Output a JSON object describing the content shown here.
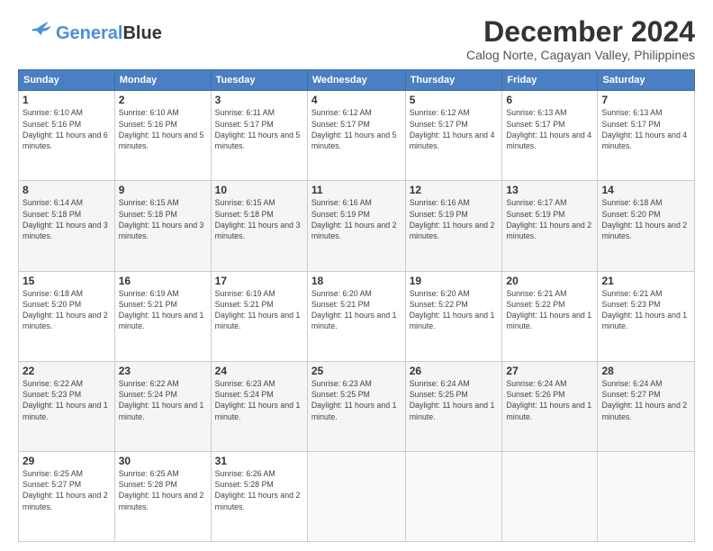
{
  "header": {
    "logo_general": "General",
    "logo_blue": "Blue",
    "month_title": "December 2024",
    "location": "Calog Norte, Cagayan Valley, Philippines"
  },
  "days_of_week": [
    "Sunday",
    "Monday",
    "Tuesday",
    "Wednesday",
    "Thursday",
    "Friday",
    "Saturday"
  ],
  "weeks": [
    [
      {
        "day": "1",
        "sunrise": "Sunrise: 6:10 AM",
        "sunset": "Sunset: 5:16 PM",
        "daylight": "Daylight: 11 hours and 6 minutes."
      },
      {
        "day": "2",
        "sunrise": "Sunrise: 6:10 AM",
        "sunset": "Sunset: 5:16 PM",
        "daylight": "Daylight: 11 hours and 5 minutes."
      },
      {
        "day": "3",
        "sunrise": "Sunrise: 6:11 AM",
        "sunset": "Sunset: 5:17 PM",
        "daylight": "Daylight: 11 hours and 5 minutes."
      },
      {
        "day": "4",
        "sunrise": "Sunrise: 6:12 AM",
        "sunset": "Sunset: 5:17 PM",
        "daylight": "Daylight: 11 hours and 5 minutes."
      },
      {
        "day": "5",
        "sunrise": "Sunrise: 6:12 AM",
        "sunset": "Sunset: 5:17 PM",
        "daylight": "Daylight: 11 hours and 4 minutes."
      },
      {
        "day": "6",
        "sunrise": "Sunrise: 6:13 AM",
        "sunset": "Sunset: 5:17 PM",
        "daylight": "Daylight: 11 hours and 4 minutes."
      },
      {
        "day": "7",
        "sunrise": "Sunrise: 6:13 AM",
        "sunset": "Sunset: 5:17 PM",
        "daylight": "Daylight: 11 hours and 4 minutes."
      }
    ],
    [
      {
        "day": "8",
        "sunrise": "Sunrise: 6:14 AM",
        "sunset": "Sunset: 5:18 PM",
        "daylight": "Daylight: 11 hours and 3 minutes."
      },
      {
        "day": "9",
        "sunrise": "Sunrise: 6:15 AM",
        "sunset": "Sunset: 5:18 PM",
        "daylight": "Daylight: 11 hours and 3 minutes."
      },
      {
        "day": "10",
        "sunrise": "Sunrise: 6:15 AM",
        "sunset": "Sunset: 5:18 PM",
        "daylight": "Daylight: 11 hours and 3 minutes."
      },
      {
        "day": "11",
        "sunrise": "Sunrise: 6:16 AM",
        "sunset": "Sunset: 5:19 PM",
        "daylight": "Daylight: 11 hours and 2 minutes."
      },
      {
        "day": "12",
        "sunrise": "Sunrise: 6:16 AM",
        "sunset": "Sunset: 5:19 PM",
        "daylight": "Daylight: 11 hours and 2 minutes."
      },
      {
        "day": "13",
        "sunrise": "Sunrise: 6:17 AM",
        "sunset": "Sunset: 5:19 PM",
        "daylight": "Daylight: 11 hours and 2 minutes."
      },
      {
        "day": "14",
        "sunrise": "Sunrise: 6:18 AM",
        "sunset": "Sunset: 5:20 PM",
        "daylight": "Daylight: 11 hours and 2 minutes."
      }
    ],
    [
      {
        "day": "15",
        "sunrise": "Sunrise: 6:18 AM",
        "sunset": "Sunset: 5:20 PM",
        "daylight": "Daylight: 11 hours and 2 minutes."
      },
      {
        "day": "16",
        "sunrise": "Sunrise: 6:19 AM",
        "sunset": "Sunset: 5:21 PM",
        "daylight": "Daylight: 11 hours and 1 minute."
      },
      {
        "day": "17",
        "sunrise": "Sunrise: 6:19 AM",
        "sunset": "Sunset: 5:21 PM",
        "daylight": "Daylight: 11 hours and 1 minute."
      },
      {
        "day": "18",
        "sunrise": "Sunrise: 6:20 AM",
        "sunset": "Sunset: 5:21 PM",
        "daylight": "Daylight: 11 hours and 1 minute."
      },
      {
        "day": "19",
        "sunrise": "Sunrise: 6:20 AM",
        "sunset": "Sunset: 5:22 PM",
        "daylight": "Daylight: 11 hours and 1 minute."
      },
      {
        "day": "20",
        "sunrise": "Sunrise: 6:21 AM",
        "sunset": "Sunset: 5:22 PM",
        "daylight": "Daylight: 11 hours and 1 minute."
      },
      {
        "day": "21",
        "sunrise": "Sunrise: 6:21 AM",
        "sunset": "Sunset: 5:23 PM",
        "daylight": "Daylight: 11 hours and 1 minute."
      }
    ],
    [
      {
        "day": "22",
        "sunrise": "Sunrise: 6:22 AM",
        "sunset": "Sunset: 5:23 PM",
        "daylight": "Daylight: 11 hours and 1 minute."
      },
      {
        "day": "23",
        "sunrise": "Sunrise: 6:22 AM",
        "sunset": "Sunset: 5:24 PM",
        "daylight": "Daylight: 11 hours and 1 minute."
      },
      {
        "day": "24",
        "sunrise": "Sunrise: 6:23 AM",
        "sunset": "Sunset: 5:24 PM",
        "daylight": "Daylight: 11 hours and 1 minute."
      },
      {
        "day": "25",
        "sunrise": "Sunrise: 6:23 AM",
        "sunset": "Sunset: 5:25 PM",
        "daylight": "Daylight: 11 hours and 1 minute."
      },
      {
        "day": "26",
        "sunrise": "Sunrise: 6:24 AM",
        "sunset": "Sunset: 5:25 PM",
        "daylight": "Daylight: 11 hours and 1 minute."
      },
      {
        "day": "27",
        "sunrise": "Sunrise: 6:24 AM",
        "sunset": "Sunset: 5:26 PM",
        "daylight": "Daylight: 11 hours and 1 minute."
      },
      {
        "day": "28",
        "sunrise": "Sunrise: 6:24 AM",
        "sunset": "Sunset: 5:27 PM",
        "daylight": "Daylight: 11 hours and 2 minutes."
      }
    ],
    [
      {
        "day": "29",
        "sunrise": "Sunrise: 6:25 AM",
        "sunset": "Sunset: 5:27 PM",
        "daylight": "Daylight: 11 hours and 2 minutes."
      },
      {
        "day": "30",
        "sunrise": "Sunrise: 6:25 AM",
        "sunset": "Sunset: 5:28 PM",
        "daylight": "Daylight: 11 hours and 2 minutes."
      },
      {
        "day": "31",
        "sunrise": "Sunrise: 6:26 AM",
        "sunset": "Sunset: 5:28 PM",
        "daylight": "Daylight: 11 hours and 2 minutes."
      },
      null,
      null,
      null,
      null
    ]
  ]
}
